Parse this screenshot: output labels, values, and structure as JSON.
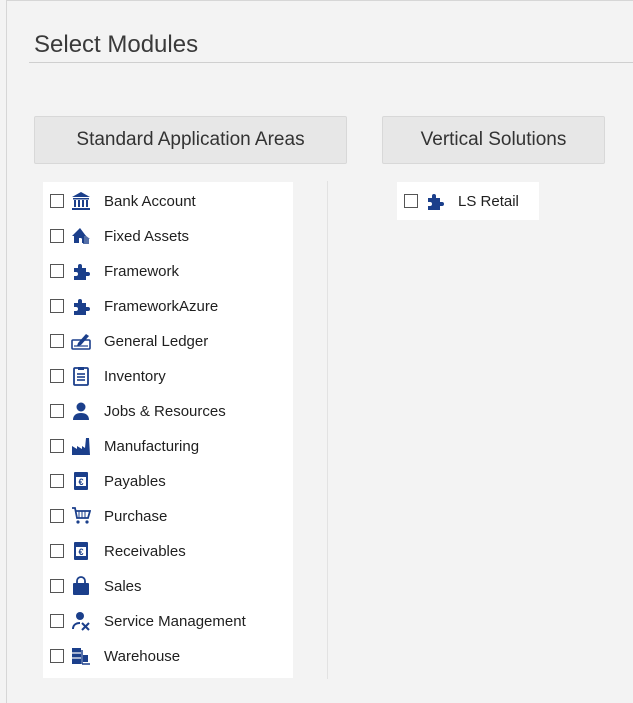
{
  "title": "Select Modules",
  "standard": {
    "header": "Standard Application Areas",
    "items": [
      {
        "label": "Bank Account",
        "icon": "bank-icon"
      },
      {
        "label": "Fixed Assets",
        "icon": "house-icon"
      },
      {
        "label": "Framework",
        "icon": "puzzle-icon"
      },
      {
        "label": "FrameworkAzure",
        "icon": "puzzle-icon"
      },
      {
        "label": "General Ledger",
        "icon": "ledger-pen-icon"
      },
      {
        "label": "Inventory",
        "icon": "clipboard-icon"
      },
      {
        "label": "Jobs & Resources",
        "icon": "person-icon"
      },
      {
        "label": "Manufacturing",
        "icon": "factory-icon"
      },
      {
        "label": "Payables",
        "icon": "euro-document-icon"
      },
      {
        "label": "Purchase",
        "icon": "shopping-cart-icon"
      },
      {
        "label": "Receivables",
        "icon": "euro-document-icon"
      },
      {
        "label": "Sales",
        "icon": "shopping-bag-icon"
      },
      {
        "label": "Service Management",
        "icon": "service-person-icon"
      },
      {
        "label": "Warehouse",
        "icon": "warehouse-icon"
      }
    ]
  },
  "vertical": {
    "header": "Vertical Solutions",
    "items": [
      {
        "label": "LS Retail",
        "icon": "puzzle-icon"
      }
    ]
  },
  "colors": {
    "icon": "#1b3f8b",
    "background": "#f3f3f3",
    "header": "#e7e7e7"
  }
}
